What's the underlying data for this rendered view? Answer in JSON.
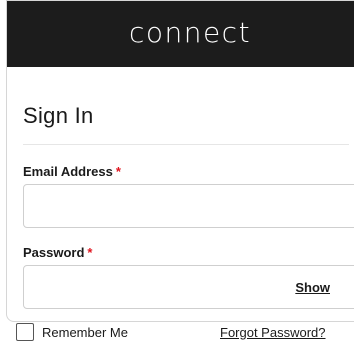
{
  "header": {
    "brand": "connect"
  },
  "form": {
    "title": "Sign In",
    "email": {
      "label": "Email Address",
      "required_marker": "*",
      "value": "",
      "placeholder": ""
    },
    "password": {
      "label": "Password",
      "required_marker": "*",
      "value": "",
      "placeholder": "",
      "show_label": "Show"
    },
    "remember_label": "Remember Me",
    "forgot_label": "Forgot Password?"
  },
  "colors": {
    "header_bg": "#1c1c1c",
    "required": "#e0141e"
  }
}
